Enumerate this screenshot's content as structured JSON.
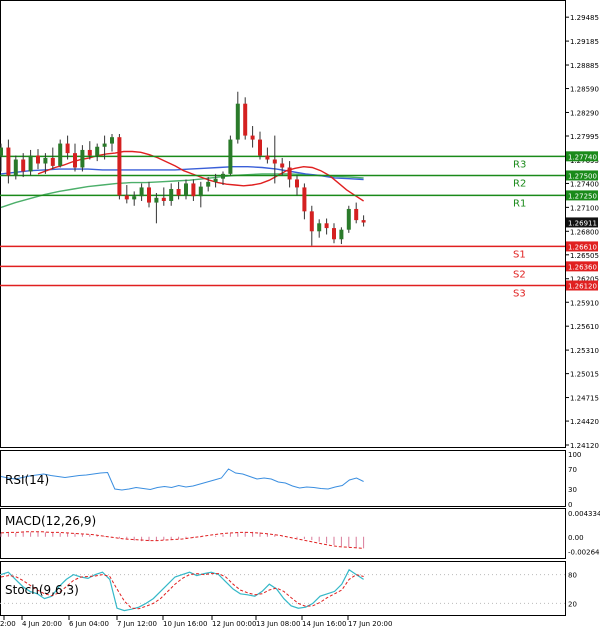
{
  "chart_data": {
    "type": "candlestick",
    "main": {
      "price_axis_ticks": [
        "1.29485",
        "1.29185",
        "1.28885",
        "1.28590",
        "1.28290",
        "1.27995",
        "1.27695",
        "1.27400",
        "1.27100",
        "1.26800",
        "1.26505",
        "1.26205",
        "1.25910",
        "1.25610",
        "1.25310",
        "1.25015",
        "1.24715",
        "1.24420",
        "1.24120"
      ],
      "ylim": [
        1.2412,
        1.296
      ],
      "current_price": "1.26911",
      "levels": [
        {
          "name": "R3",
          "tag": "1.27740",
          "value": 1.2774,
          "color": "#1a8a1a"
        },
        {
          "name": "R2",
          "tag": "1.27500",
          "value": 1.275,
          "color": "#1a8a1a"
        },
        {
          "name": "R1",
          "tag": "1.27250",
          "value": 1.2725,
          "color": "#1a8a1a"
        },
        {
          "name": "S1",
          "tag": "1.26610",
          "value": 1.2661,
          "color": "#e02020"
        },
        {
          "name": "S2",
          "tag": "1.26360",
          "value": 1.2636,
          "color": "#e02020"
        },
        {
          "name": "S3",
          "tag": "1.26120",
          "value": 1.2612,
          "color": "#e02020"
        }
      ],
      "candles": [
        [
          1.2775,
          1.279,
          1.2755,
          1.2785
        ],
        [
          1.2785,
          1.2795,
          1.274,
          1.275
        ],
        [
          1.275,
          1.2775,
          1.2745,
          1.277
        ],
        [
          1.277,
          1.2778,
          1.2748,
          1.2755
        ],
        [
          1.2755,
          1.2782,
          1.275,
          1.2775
        ],
        [
          1.2775,
          1.2783,
          1.2758,
          1.2765
        ],
        [
          1.2765,
          1.2778,
          1.2752,
          1.2772
        ],
        [
          1.2772,
          1.2785,
          1.2758,
          1.2762
        ],
        [
          1.2762,
          1.2795,
          1.276,
          1.279
        ],
        [
          1.279,
          1.28,
          1.277,
          1.2778
        ],
        [
          1.2778,
          1.279,
          1.2755,
          1.276
        ],
        [
          1.276,
          1.2788,
          1.2755,
          1.2782
        ],
        [
          1.2782,
          1.2793,
          1.277,
          1.2775
        ],
        [
          1.2775,
          1.279,
          1.2768,
          1.2786
        ],
        [
          1.2786,
          1.28,
          1.277,
          1.279
        ],
        [
          1.279,
          1.2802,
          1.278,
          1.2798
        ],
        [
          1.2798,
          1.2802,
          1.272,
          1.2725
        ],
        [
          1.2725,
          1.2738,
          1.2715,
          1.272
        ],
        [
          1.272,
          1.273,
          1.2712,
          1.2724
        ],
        [
          1.2724,
          1.274,
          1.2718,
          1.2735
        ],
        [
          1.2735,
          1.2742,
          1.271,
          1.2716
        ],
        [
          1.2716,
          1.2728,
          1.269,
          1.2722
        ],
        [
          1.2722,
          1.2735,
          1.2712,
          1.2718
        ],
        [
          1.2718,
          1.274,
          1.2712,
          1.2733
        ],
        [
          1.2733,
          1.2742,
          1.272,
          1.2725
        ],
        [
          1.2725,
          1.2745,
          1.272,
          1.274
        ],
        [
          1.274,
          1.2745,
          1.2718,
          1.2724
        ],
        [
          1.2724,
          1.2742,
          1.271,
          1.2736
        ],
        [
          1.2736,
          1.2748,
          1.273,
          1.2742
        ],
        [
          1.2742,
          1.2752,
          1.2735,
          1.2746
        ],
        [
          1.2746,
          1.2755,
          1.2738,
          1.2752
        ],
        [
          1.2752,
          1.28,
          1.275,
          1.2795
        ],
        [
          1.2795,
          1.2855,
          1.279,
          1.284
        ],
        [
          1.284,
          1.2848,
          1.2795,
          1.28
        ],
        [
          1.28,
          1.2812,
          1.2785,
          1.2795
        ],
        [
          1.2795,
          1.2805,
          1.277,
          1.2775
        ],
        [
          1.2775,
          1.2785,
          1.2765,
          1.277
        ],
        [
          1.277,
          1.28,
          1.274,
          1.2765
        ],
        [
          1.2765,
          1.2772,
          1.275,
          1.276
        ],
        [
          1.276,
          1.2768,
          1.2735,
          1.2745
        ],
        [
          1.2745,
          1.275,
          1.2725,
          1.2735
        ],
        [
          1.2735,
          1.274,
          1.2695,
          1.2705
        ],
        [
          1.2705,
          1.2712,
          1.2662,
          1.268
        ],
        [
          1.268,
          1.2695,
          1.2672,
          1.269
        ],
        [
          1.269,
          1.2696,
          1.2676,
          1.2684
        ],
        [
          1.2684,
          1.269,
          1.2665,
          1.267
        ],
        [
          1.267,
          1.2685,
          1.2664,
          1.2682
        ],
        [
          1.2682,
          1.2712,
          1.2678,
          1.2708
        ],
        [
          1.2708,
          1.2716,
          1.269,
          1.2694
        ],
        [
          1.2694,
          1.27,
          1.2686,
          1.2691
        ]
      ],
      "ma_red": [
        1.2752,
        1.2756,
        1.276,
        1.2763,
        1.2767,
        1.277,
        1.2772,
        1.2775,
        1.2777,
        1.2778,
        1.278,
        1.278,
        1.2779,
        1.2776,
        1.2772,
        1.2767,
        1.2762,
        1.2756,
        1.2752,
        1.2748,
        1.2744,
        1.2741,
        1.2739,
        1.2738,
        1.2737,
        1.2738,
        1.274,
        1.2744,
        1.275,
        1.2756,
        1.2759,
        1.2761,
        1.276,
        1.2756,
        1.275,
        1.2741,
        1.2732,
        1.2725,
        1.2718
      ],
      "ma_blue": [
        1.2752,
        1.2754,
        1.2756,
        1.2757,
        1.2758,
        1.2758,
        1.2758,
        1.2757,
        1.2757,
        1.2757,
        1.2757,
        1.2757,
        1.2757,
        1.2758,
        1.2759,
        1.276,
        1.2761,
        1.2761,
        1.276,
        1.2758,
        1.2755,
        1.2752,
        1.275,
        1.2747,
        1.2746,
        1.2745
      ],
      "ma_green": [
        1.271,
        1.2716,
        1.2721,
        1.2726,
        1.273,
        1.2733,
        1.2736,
        1.2738,
        1.274,
        1.2741,
        1.2741,
        1.2742,
        1.2743,
        1.2744,
        1.2746,
        1.2748,
        1.275,
        1.2751,
        1.2752,
        1.2752,
        1.2752,
        1.2751,
        1.275,
        1.2749,
        1.2748,
        1.2747
      ]
    },
    "rsi": {
      "label": "RSI(14)",
      "axis_ticks": [
        "100",
        "70",
        "30",
        "0"
      ],
      "ylim": [
        0,
        100
      ],
      "values": [
        55,
        52,
        50,
        53,
        56,
        58,
        60,
        57,
        55,
        53,
        55,
        57,
        58,
        60,
        62,
        63,
        30,
        28,
        30,
        33,
        31,
        29,
        33,
        35,
        33,
        37,
        34,
        36,
        40,
        44,
        48,
        52,
        70,
        62,
        60,
        55,
        50,
        52,
        50,
        44,
        42,
        36,
        32,
        34,
        33,
        31,
        30,
        34,
        37,
        48,
        52,
        45
      ]
    },
    "macd": {
      "label": "MACD(12,26,9)",
      "axis_ticks": [
        "0.004334",
        "0.00",
        "-0.002642"
      ],
      "ylim": [
        -0.0035,
        0.0045
      ],
      "histogram": [
        0.0006,
        0.0007,
        0.0007,
        0.0008,
        0.0008,
        0.0009,
        0.0008,
        0.0008,
        0.0007,
        0.0007,
        0.0006,
        0.0005,
        0.0004,
        0.0003,
        0.0001,
        -0.0001,
        -0.0003,
        -0.0005,
        -0.0007,
        -0.0008,
        -0.0008,
        -0.0007,
        -0.0006,
        -0.0005,
        -0.0004,
        -0.0003,
        -0.0002,
        -0.0001,
        0.0,
        0.0002,
        0.0004,
        0.0006,
        0.0008,
        0.0009,
        0.0009,
        0.0008,
        0.0006,
        0.0004,
        0.0002,
        0.0,
        -0.0002,
        -0.0004,
        -0.0006,
        -0.0009,
        -0.0012,
        -0.0015,
        -0.0017,
        -0.0019,
        -0.002,
        -0.0021
      ],
      "signal": [
        0.0007,
        0.0008,
        0.0008,
        0.0009,
        0.0009,
        0.0009,
        0.0008,
        0.0008,
        0.0007,
        0.0006,
        0.0005,
        0.0004,
        0.0002,
        0.0,
        -0.0002,
        -0.0004,
        -0.0005,
        -0.0006,
        -0.0007,
        -0.0007,
        -0.0006,
        -0.0005,
        -0.0004,
        -0.0002,
        0.0,
        0.0002,
        0.0004,
        0.0006,
        0.0007,
        0.0008,
        0.0008,
        0.0007,
        0.0006,
        0.0004,
        0.0002,
        -0.0001,
        -0.0004,
        -0.0007,
        -0.001,
        -0.0013,
        -0.0016,
        -0.0018,
        -0.0019,
        -0.002,
        -0.0021
      ]
    },
    "stoch": {
      "label": "Stoch(9,6,3)",
      "axis_ticks": [
        "80",
        "20"
      ],
      "ylim": [
        0,
        100
      ],
      "k": [
        80,
        85,
        70,
        55,
        45,
        40,
        30,
        35,
        55,
        70,
        80,
        75,
        72,
        80,
        85,
        70,
        10,
        5,
        8,
        12,
        20,
        30,
        45,
        60,
        75,
        80,
        85,
        78,
        82,
        85,
        80,
        65,
        50,
        40,
        38,
        35,
        45,
        60,
        50,
        30,
        15,
        10,
        12,
        20,
        35,
        40,
        45,
        60,
        90,
        80,
        70
      ],
      "d": [
        75,
        78,
        76,
        68,
        58,
        48,
        40,
        36,
        42,
        55,
        68,
        75,
        76,
        77,
        80,
        76,
        50,
        25,
        10,
        9,
        14,
        20,
        30,
        45,
        60,
        72,
        80,
        82,
        80,
        82,
        82,
        75,
        60,
        48,
        42,
        38,
        40,
        48,
        52,
        45,
        32,
        20,
        14,
        15,
        22,
        32,
        40,
        48,
        70,
        80,
        76
      ]
    },
    "x_tick_labels": [
      "2:00",
      "4 Jun 20:00",
      "6 Jun 04:00",
      "7 Jun 12:00",
      "10 Jun 16:00",
      "12 Jun 00:00",
      "13 Jun 08:00",
      "14 Jun 16:00",
      "17 Jun 20:00"
    ],
    "colors": {
      "up_candle": "#2a7a2a",
      "down_candle": "#d42020",
      "ma_red": "#e02020",
      "ma_blue": "#3a5fd8",
      "ma_green": "#4caf6a",
      "rsi_line": "#3a8ee0",
      "stoch_k": "#35b8c8",
      "stoch_d": "#e02020",
      "macd_hist": "#d87a9a",
      "macd_signal": "#e02020"
    }
  }
}
